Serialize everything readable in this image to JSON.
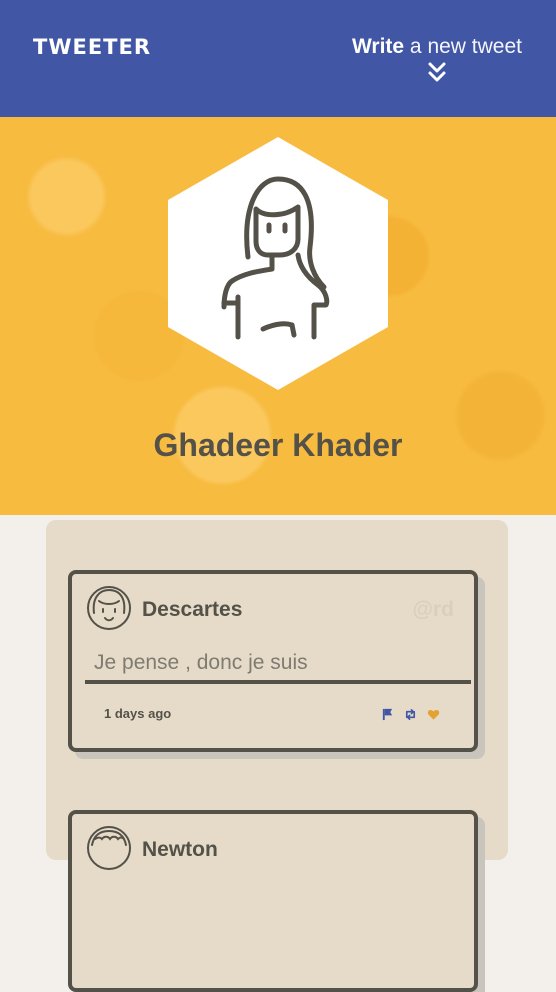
{
  "header": {
    "logo": "TWEETER",
    "compose_bold": "Write",
    "compose_rest": " a new tweet",
    "compose_icon": "chevron-double-down-icon"
  },
  "profile": {
    "name": "Ghadeer Khader",
    "avatar_icon": "user-avatar-icon",
    "banner_color": "#f7bb3f"
  },
  "feed": {
    "tweets": [
      {
        "author": "Descartes",
        "handle": "@rd",
        "text": "Je pense , donc je suis",
        "time": "1 days ago",
        "actions": [
          "flag-icon",
          "retweet-icon",
          "heart-icon"
        ]
      },
      {
        "author": "Newton",
        "handle": ""
      }
    ]
  },
  "colors": {
    "header": "#4157a6",
    "text": "#545149",
    "card": "#e6dbc8",
    "page": "#f3f0ec",
    "flag": "#4157a6",
    "retweet": "#4157a6",
    "heart": "#e3a232",
    "handle": "#d9cfbf"
  }
}
